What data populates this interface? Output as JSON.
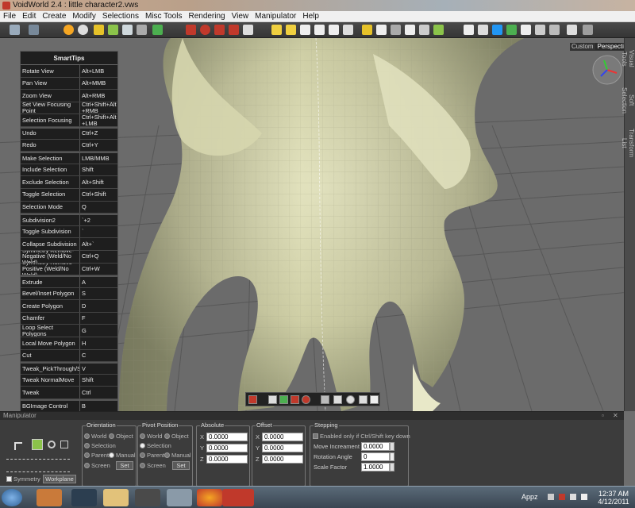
{
  "window": {
    "title": "VoidWorld 2.4 : little character2.vws"
  },
  "menu": [
    "File",
    "Edit",
    "Create",
    "Modify",
    "Selections",
    "Misc Tools",
    "Rendering",
    "View",
    "Manipulator",
    "Help"
  ],
  "viewport": {
    "view_custom": "Custom",
    "view_name": "Perspective",
    "model_color": "#dcdcb6",
    "grid_color": "#4a4a4a"
  },
  "right_tabs": [
    "Visual Tools",
    "Soft Selection",
    "Transform List"
  ],
  "smarttips": {
    "title": "SmartTips",
    "rows": [
      {
        "cmd": "Rotate View",
        "key": "Alt+LMB"
      },
      {
        "cmd": "Pan View",
        "key": "Alt+MMB"
      },
      {
        "cmd": "Zoom View",
        "key": "Alt+RMB"
      },
      {
        "cmd": "Set View Focusing Point",
        "key": "Ctrl+Shift+Alt +RMB"
      },
      {
        "cmd": "Selection Focusing",
        "key": "Ctrl+Shift+Alt +LMB"
      },
      {
        "cmd": "Undo",
        "key": "Ctrl+Z"
      },
      {
        "cmd": "Redo",
        "key": "Ctrl+Y"
      },
      {
        "cmd": "Make Selection",
        "key": "LMB/MMB"
      },
      {
        "cmd": "Include Selection",
        "key": "Shift"
      },
      {
        "cmd": "Exclude Selection",
        "key": "Alt+Shift"
      },
      {
        "cmd": "Toggle Selection",
        "key": "Ctrl+Shift"
      },
      {
        "cmd": "Selection Mode",
        "key": "Q"
      },
      {
        "cmd": "Subdivision2",
        "key": "`+2"
      },
      {
        "cmd": "Toggle Subdivision",
        "key": "`"
      },
      {
        "cmd": "Collapse Subdivision",
        "key": "Alt+`"
      },
      {
        "cmd": "Symmetry Remove-Negative (Weld/No Weld)",
        "key": "Ctrl+Q"
      },
      {
        "cmd": "Symmetry Remove-Positive (Weld/No Weld)",
        "key": "Ctrl+W"
      },
      {
        "cmd": "Extrude",
        "key": "A"
      },
      {
        "cmd": "Bevel/Inset Polygon",
        "key": "S"
      },
      {
        "cmd": "Create Polygon",
        "key": "D"
      },
      {
        "cmd": "Chamfer",
        "key": "F"
      },
      {
        "cmd": "Loop Select Polygons",
        "key": "G"
      },
      {
        "cmd": "Local Move Polygon",
        "key": "H"
      },
      {
        "cmd": "Cut",
        "key": "C"
      },
      {
        "cmd": "Tweak_PickThrough/SlideSelection",
        "key": "V"
      },
      {
        "cmd": "Tweak NormalMove",
        "key": "Shift"
      },
      {
        "cmd": "Tweak",
        "key": "Ctrl"
      },
      {
        "cmd": "BGImage Control",
        "key": "B"
      }
    ]
  },
  "manipulator": {
    "header": "Manipulator",
    "symmetry_label": "Symmetry",
    "workplane_label": "Workplane",
    "orientation": {
      "title": "Orientation",
      "world": "World",
      "object": "Object",
      "selection": "Selection",
      "parent": "Parent",
      "manual": "Manual",
      "screen": "Screen",
      "set": "Set"
    },
    "pivot": {
      "title": "Pivot Position",
      "world": "World",
      "object": "Object",
      "selection": "Selection",
      "parent": "Parent",
      "manual": "Manual",
      "screen": "Screen",
      "set": "Set"
    },
    "absolute": {
      "title": "Absolute",
      "x_label": "X",
      "y_label": "Y",
      "z_label": "Z",
      "x": "0.0000",
      "y": "0.0000",
      "z": "0.0000"
    },
    "offset": {
      "title": "Offset",
      "x_label": "X",
      "y_label": "Y",
      "z_label": "Z",
      "x": "0.0000",
      "y": "0.0000",
      "z": "0.0000"
    },
    "stepping": {
      "title": "Stepping",
      "enabled_label": "Enabled only if Ctrl/Shift key down",
      "move_label": "Move Increament",
      "move_value": "0.0000",
      "rotation_label": "Rotation Angle",
      "rotation_value": "0",
      "scale_label": "Scale Factor",
      "scale_value": "1.0000"
    }
  },
  "taskbar": {
    "appz": "Appz",
    "time": "12:37 AM",
    "date": "4/12/2011"
  }
}
